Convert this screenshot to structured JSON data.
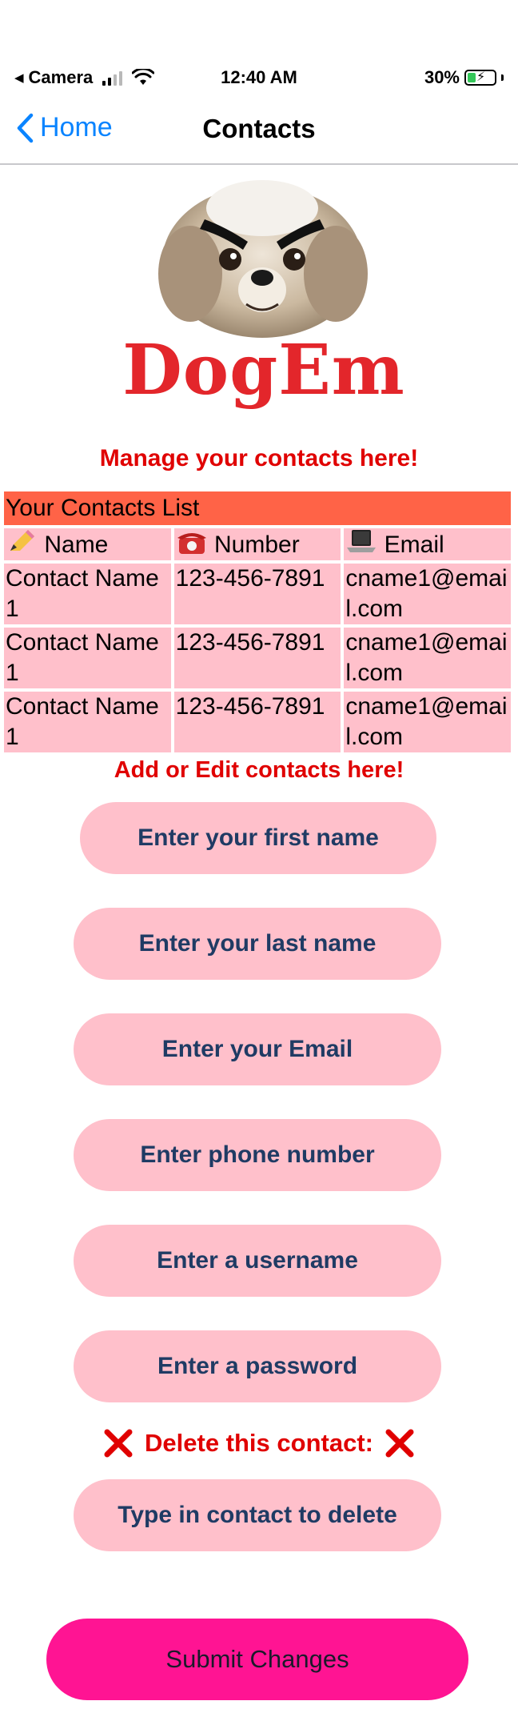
{
  "status_bar": {
    "back_app": "Camera",
    "time": "12:40 AM",
    "battery": "30%",
    "battery_level": 0.3
  },
  "nav": {
    "back_label": "Home",
    "title": "Contacts"
  },
  "logo": {
    "text": "DogEm"
  },
  "manage_heading": "Manage your contacts here!",
  "contacts_table": {
    "caption": "Your Contacts List",
    "headers": [
      {
        "icon": "pencil-icon",
        "label": "Name"
      },
      {
        "icon": "telephone-icon",
        "label": "Number"
      },
      {
        "icon": "laptop-icon",
        "label": "Email"
      }
    ],
    "rows": [
      {
        "name": "Contact Name1",
        "number": "123-456-7891",
        "email": "cname1@email.com"
      },
      {
        "name": "Contact Name1",
        "number": "123-456-7891",
        "email": "cname1@email.com"
      },
      {
        "name": "Contact Name1",
        "number": "123-456-7891",
        "email": "cname1@email.com"
      }
    ]
  },
  "edit_heading": "Add or Edit contacts here!",
  "fields": {
    "first_name": "Enter your first name",
    "last_name": "Enter your last name",
    "email": "Enter your Email",
    "phone": "Enter phone number",
    "username": "Enter a username",
    "password": "Enter a password"
  },
  "delete": {
    "label": "Delete this contact:",
    "placeholder": "Type in contact to delete"
  },
  "submit_label": "Submit Changes",
  "colors": {
    "accent_blue": "#0a84ff",
    "heading_red": "#e00000",
    "table_header": "#ff6347",
    "pink": "#ffc0cb",
    "submit": "#ff1493",
    "field_text": "#1f3b64"
  }
}
